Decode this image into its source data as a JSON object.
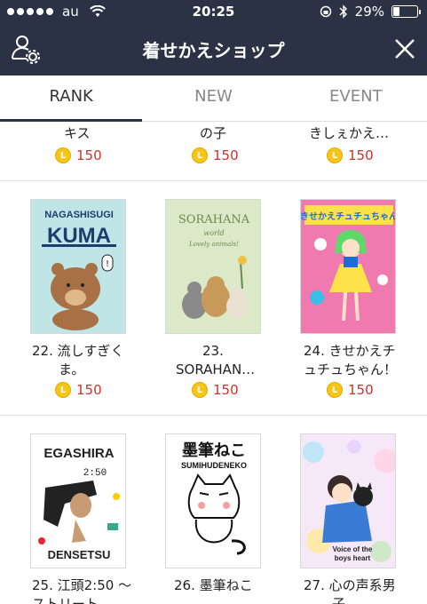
{
  "status": {
    "carrier": "au",
    "time": "20:25",
    "battery": "29%",
    "battery_level": 0.29
  },
  "header": {
    "title": "着せかえショップ"
  },
  "tabs": [
    {
      "label": "RANK",
      "active": true
    },
    {
      "label": "NEW",
      "active": false
    },
    {
      "label": "EVENT",
      "active": false
    }
  ],
  "partial_row": [
    {
      "name": "キス",
      "price": "150"
    },
    {
      "name": "の子",
      "price": "150"
    },
    {
      "name": "きしぇかえ…",
      "price": "150"
    }
  ],
  "row2": [
    {
      "name_l1": "22. 流しすぎく",
      "name_l2": "ま。",
      "price": "150",
      "cover_text": [
        "NAGASHISUGI",
        "KUMA"
      ]
    },
    {
      "name_l1": "23.",
      "name_l2": "SORAHAN…",
      "price": "150",
      "cover_text": [
        "SORAHANA",
        "world",
        "Lovely animals!"
      ]
    },
    {
      "name_l1": "24. きせかえチ",
      "name_l2": "ュチュちゃん！",
      "price": "150",
      "cover_text": [
        "きせかえチュチュちゃん"
      ]
    }
  ],
  "row3": [
    {
      "name_l1": "25. 江頭2:50 〜",
      "name_l2": "ストリート",
      "cover_text": [
        "EGASHIRA",
        "2:50",
        "DENSETSU"
      ]
    },
    {
      "name_l1": "26. 墨筆ねこ",
      "cover_text": [
        "墨筆ねこ",
        "SUMIHUDENEKO"
      ]
    },
    {
      "name_l1": "27. 心の声系男",
      "name_l2": "子",
      "cover_text": [
        "Voice of the",
        "boys heart"
      ]
    }
  ],
  "coin_glyph": "L",
  "colors": {
    "header_bg": "#2a3244",
    "price": "#d0302c",
    "coin": "#f5c518"
  }
}
